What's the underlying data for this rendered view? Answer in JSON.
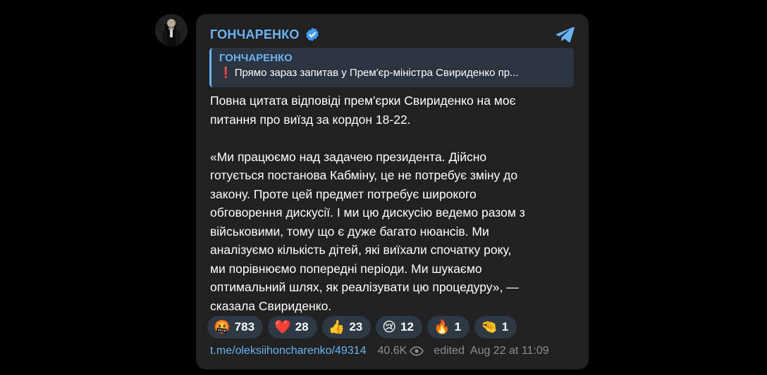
{
  "channel": {
    "name": "ГОНЧАРЕНКО",
    "verified_icon": "verified-badge-icon",
    "share_icon": "telegram-paper-plane-icon"
  },
  "reply": {
    "author": "ГОНЧАРЕНКО",
    "marker": "❗",
    "text": "Прямо зараз запитав у Прем'єр-міністра Свириденко пр..."
  },
  "message": {
    "text": "Повна цитата відповіді прем'єрки Свириденко на моє\nпитання про виїзд за кордон 18-22.\n\n«Ми працюємо над задачею президента. Дійсно\nготується постанова Кабміну, це не потребує зміну до\nзакону. Проте цей предмет потребує широкого\nобговорення дискусії. І ми цю дискусію ведемо разом з\nвійськовими, тому що є дуже багато нюансів. Ми\nаналізуємо кількість дітей, які виїхали спочатку року,\nми порівнюємо попередні періоди. Ми шукаємо\nоптимальний шлях, як реалізувати цю процедуру», —\nсказала Свириденко."
  },
  "reactions": [
    {
      "emoji": "🤬",
      "count": "783",
      "name": "angry-face"
    },
    {
      "emoji": "❤️",
      "count": "28",
      "name": "red-heart"
    },
    {
      "emoji": "👍",
      "count": "23",
      "name": "thumbs-up"
    },
    {
      "emoji": "😢",
      "count": "12",
      "name": "crying-face"
    },
    {
      "emoji": "🔥",
      "count": "1",
      "name": "fire"
    },
    {
      "emoji": "🤏",
      "count": "1",
      "name": "pinching-hand"
    }
  ],
  "footer": {
    "link": "t.me/oleksiihoncharenko/49314",
    "views": "40.6K",
    "eye_icon": "eye-icon",
    "edited": "edited",
    "time": "Aug 22 at 11:09"
  },
  "colors": {
    "accent": "#6ab3f3",
    "card_bg": "#212121",
    "reply_bg": "#2b3440",
    "reaction_bg": "#2e3946"
  }
}
